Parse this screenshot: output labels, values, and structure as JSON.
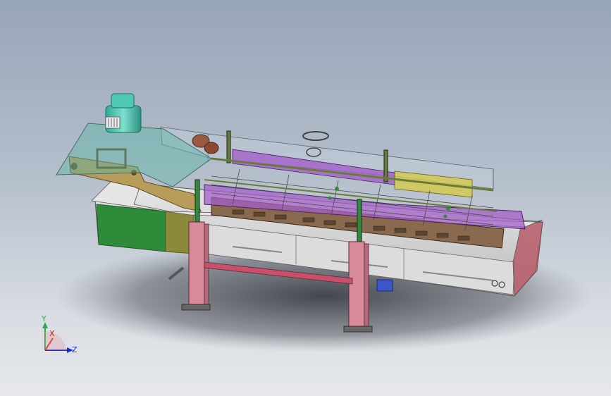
{
  "viewport": {
    "background_top": "#97a5b8",
    "background_bottom": "#e6e8eb"
  },
  "triad": {
    "x_label": "X",
    "y_label": "Y",
    "z_label": "Z",
    "x_color": "#d11a1a",
    "y_color": "#22b14c",
    "z_color": "#1b2fd6"
  },
  "model": {
    "name_icon": "conveyor-machine-model",
    "colors": {
      "motor": "#4fc9b5",
      "frame_tan": "#b89c5a",
      "frame_purple": "#a35fc9",
      "frame_brown": "#8a6a4e",
      "leg_pink": "#d98a9a",
      "base_green": "#2e8b3a",
      "olive": "#8a8a3a",
      "tank_grey": "#d6d6d6",
      "glass": "#c8d6e0",
      "yellow": "#d4c94a",
      "blue_box": "#3d55c9"
    }
  }
}
